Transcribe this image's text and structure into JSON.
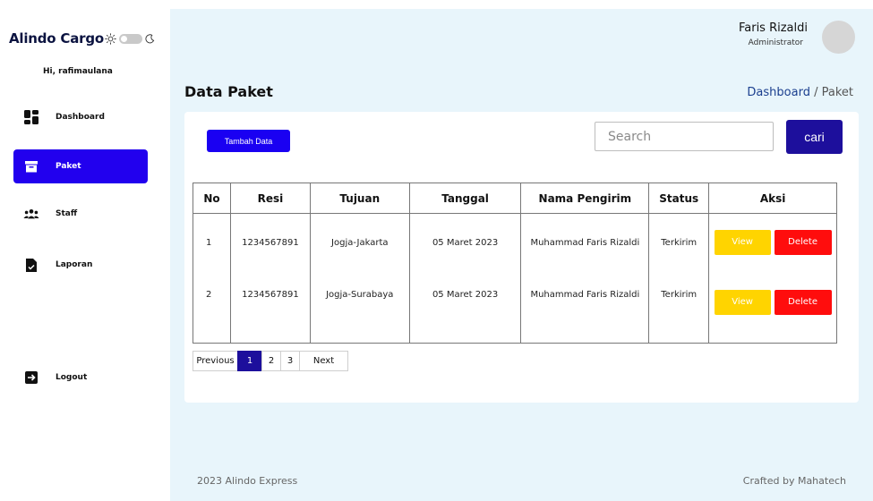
{
  "sidebar": {
    "brand": "Alindo Cargo",
    "greeting": "Hi, rafimaulana",
    "items": [
      {
        "label": "Dashboard",
        "icon": "dashboard-icon",
        "active": false
      },
      {
        "label": "Paket",
        "icon": "package-icon",
        "active": true
      },
      {
        "label": "Staff",
        "icon": "users-icon",
        "active": false
      },
      {
        "label": "Laporan",
        "icon": "document-icon",
        "active": false
      },
      {
        "label": "Logout",
        "icon": "logout-icon",
        "active": false
      }
    ]
  },
  "header": {
    "user_name": "Faris Rizaldi",
    "user_role": "Administrator"
  },
  "page": {
    "title": "Data Paket",
    "breadcrumb": {
      "link": "Dashboard",
      "separator": " / ",
      "current": "Paket"
    }
  },
  "toolbar": {
    "add_label": "Tambah Data",
    "search_placeholder": "Search",
    "search_value": "",
    "search_button": "cari"
  },
  "table": {
    "columns": [
      "No",
      "Resi",
      "Tujuan",
      "Tanggal",
      "Nama Pengirim",
      "Status",
      "Aksi"
    ],
    "rows": [
      {
        "no": "1",
        "resi": "1234567891",
        "tujuan": "Jogja-Jakarta",
        "tanggal": "05 Maret 2023",
        "pengirim": "Muhammad Faris Rizaldi",
        "status": "Terkirim",
        "view": "View",
        "delete": "Delete"
      },
      {
        "no": "2",
        "resi": "1234567891",
        "tujuan": "Jogja-Surabaya",
        "tanggal": "05 Maret 2023",
        "pengirim": "Muhammad Faris Rizaldi",
        "status": "Terkirim",
        "view": "View",
        "delete": "Delete"
      }
    ]
  },
  "pagination": {
    "previous": "Previous",
    "pages": [
      "1",
      "2",
      "3"
    ],
    "current": "1",
    "next": "Next"
  },
  "footer": {
    "left": "2023 Alindo Express",
    "right": "Crafted by Mahatech"
  },
  "colors": {
    "accent": "#2200ee",
    "button_dark": "#1d0f9c",
    "view": "#ffd400",
    "delete": "#ff0d0d",
    "main_bg": "#e8f5fb"
  }
}
